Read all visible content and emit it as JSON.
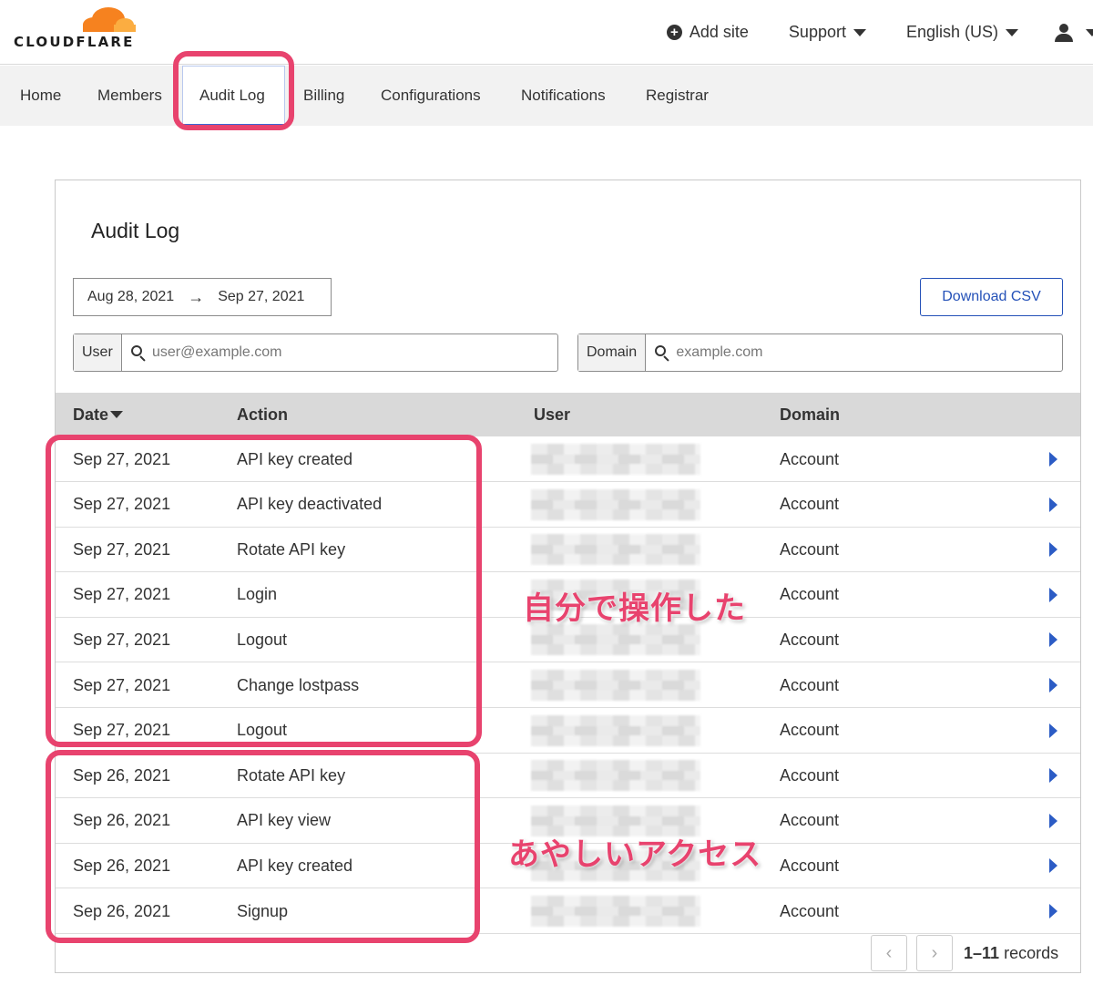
{
  "brand": {
    "name": "CLOUDFLARE",
    "cloud_color": "#f6821f",
    "cloud_light_color": "#fbad41"
  },
  "header": {
    "add_site": "Add site",
    "support": "Support",
    "language": "English (US)"
  },
  "nav": {
    "tabs": [
      {
        "label": "Home"
      },
      {
        "label": "Members"
      },
      {
        "label": "Audit Log",
        "active": true
      },
      {
        "label": "Billing"
      },
      {
        "label": "Configurations"
      },
      {
        "label": "Notifications"
      },
      {
        "label": "Registrar"
      }
    ]
  },
  "audit": {
    "title": "Audit Log",
    "date_from": "Aug 28, 2021",
    "date_arrow": "→",
    "date_to": "Sep 27, 2021",
    "download_csv": "Download CSV",
    "user_filter": {
      "label": "User",
      "placeholder": "user@example.com"
    },
    "domain_filter": {
      "label": "Domain",
      "placeholder": "example.com"
    },
    "columns": {
      "date": "Date",
      "action": "Action",
      "user": "User",
      "domain": "Domain"
    },
    "rows": [
      {
        "date": "Sep 27, 2021",
        "action": "API key created",
        "domain": "Account"
      },
      {
        "date": "Sep 27, 2021",
        "action": "API key deactivated",
        "domain": "Account"
      },
      {
        "date": "Sep 27, 2021",
        "action": "Rotate API key",
        "domain": "Account"
      },
      {
        "date": "Sep 27, 2021",
        "action": "Login",
        "domain": "Account"
      },
      {
        "date": "Sep 27, 2021",
        "action": "Logout",
        "domain": "Account"
      },
      {
        "date": "Sep 27, 2021",
        "action": "Change lostpass",
        "domain": "Account"
      },
      {
        "date": "Sep 27, 2021",
        "action": "Logout",
        "domain": "Account"
      },
      {
        "date": "Sep 26, 2021",
        "action": "Rotate API key",
        "domain": "Account"
      },
      {
        "date": "Sep 26, 2021",
        "action": "API key view",
        "domain": "Account"
      },
      {
        "date": "Sep 26, 2021",
        "action": "API key created",
        "domain": "Account"
      },
      {
        "date": "Sep 26, 2021",
        "action": "Signup",
        "domain": "Account"
      }
    ],
    "pagination": {
      "prev": "‹",
      "next": "›",
      "range": "1–11",
      "suffix": "records"
    }
  },
  "annotations": {
    "self_operated": "自分で操作した",
    "suspicious_access": "あやしいアクセス",
    "color": "#e8436e"
  }
}
